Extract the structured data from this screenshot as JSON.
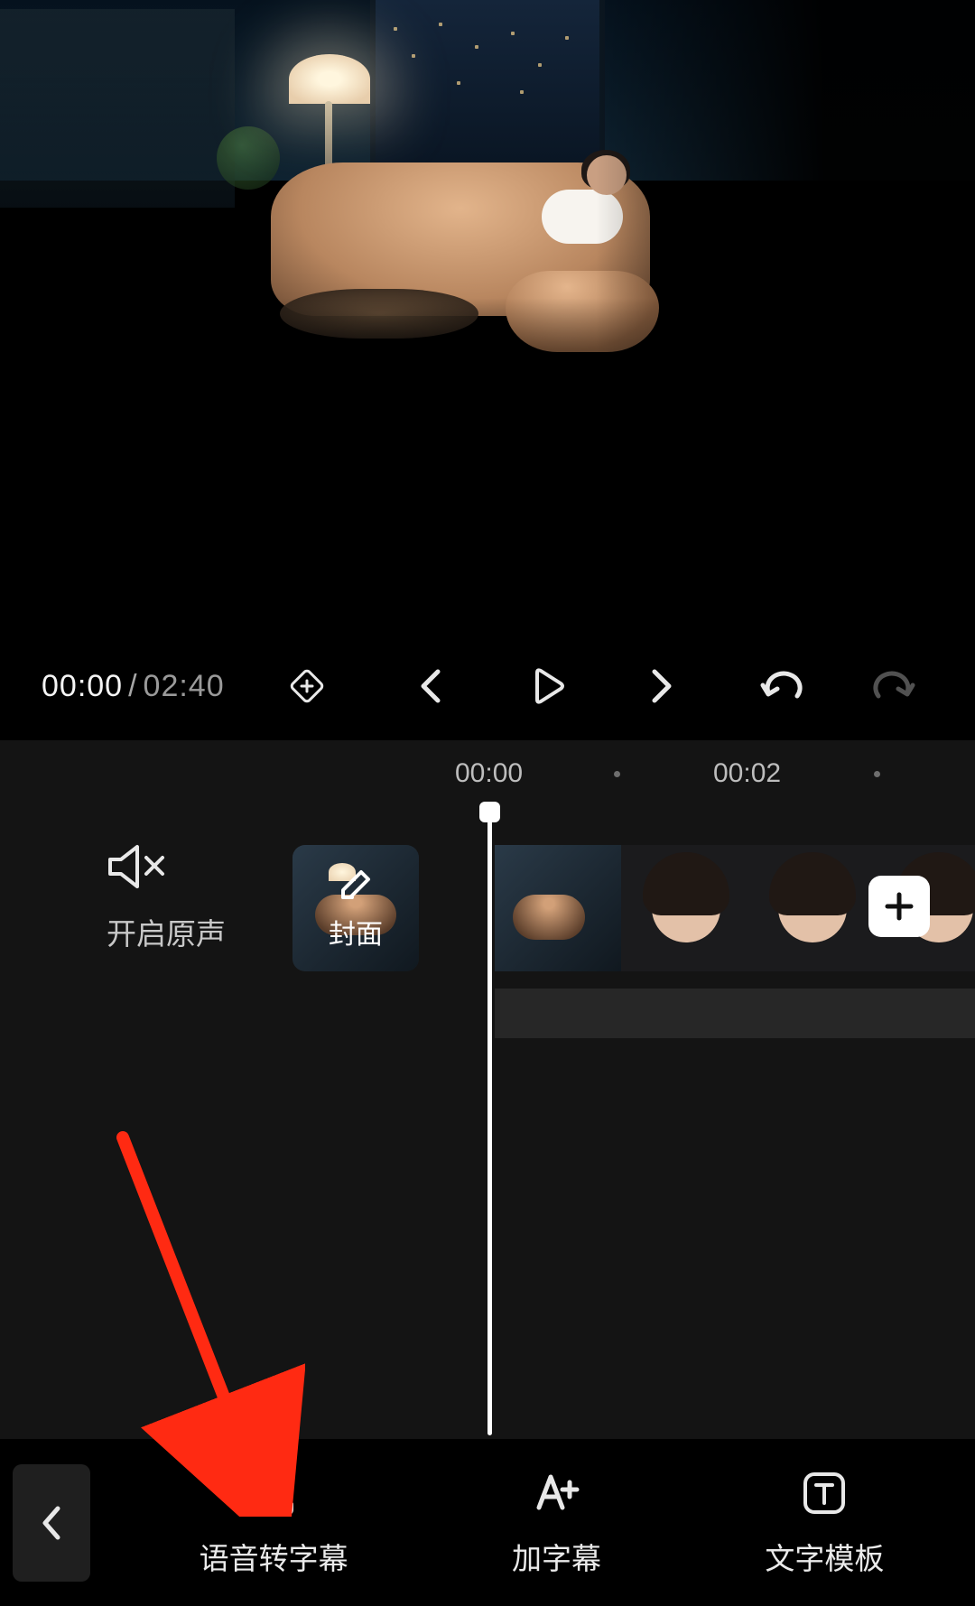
{
  "player": {
    "currentTime": "00:00",
    "totalTime": "02:40"
  },
  "ruler": {
    "t0": "00:00",
    "t2": "00:02"
  },
  "timeline": {
    "muteLabel": "开启原声",
    "coverLabel": "封面"
  },
  "toolbar": {
    "speechToSubtitle": "语音转字幕",
    "addSubtitle": "加字幕",
    "textTemplate": "文字模板"
  }
}
